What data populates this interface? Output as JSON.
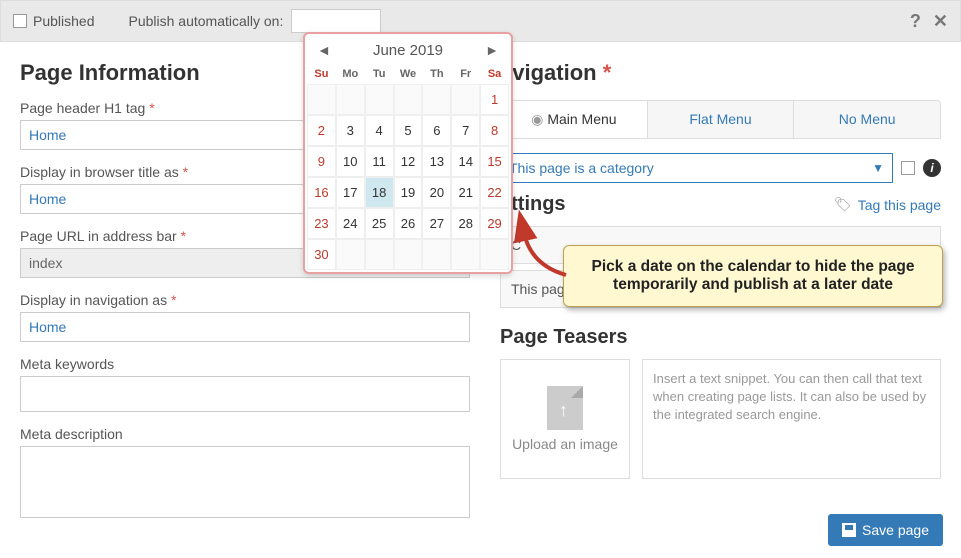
{
  "topbar": {
    "published_label": "Published",
    "publish_auto_label": "Publish automatically on:",
    "help_icon": "?",
    "close_icon": "✕"
  },
  "page_info": {
    "title": "Page Information",
    "fields": {
      "h1_label": "Page header H1 tag",
      "h1_value": "Home",
      "browser_title_label": "Display in browser title as",
      "browser_title_value": "Home",
      "url_label": "Page URL in address bar",
      "url_value": "index",
      "nav_label": "Display in navigation as",
      "nav_value": "Home",
      "meta_kw_label": "Meta keywords",
      "meta_desc_label": "Meta description"
    },
    "req_mark": "*"
  },
  "navigation": {
    "title": "avigation",
    "tabs": {
      "main": "Main Menu",
      "flat": "Flat Menu",
      "none": "No Menu"
    },
    "category_select": "This page is a category"
  },
  "settings": {
    "title": "ettings",
    "tag_link": "Tag this page",
    "current_row": "C",
    "teaser_row": "This page"
  },
  "teasers": {
    "title": "Page Teasers",
    "upload_label": "Upload an image",
    "snippet_placeholder": "Insert a text snippet. You can then call that text when creating page lists. It can also be used by the integrated search engine."
  },
  "save_button": "Save page",
  "calendar": {
    "title": "June 2019",
    "day_headers": [
      "Su",
      "Mo",
      "Tu",
      "We",
      "Th",
      "Fr",
      "Sa"
    ],
    "weeks": [
      [
        null,
        null,
        null,
        null,
        null,
        null,
        {
          "n": 1,
          "we": true
        }
      ],
      [
        {
          "n": 2,
          "we": true
        },
        {
          "n": 3
        },
        {
          "n": 4
        },
        {
          "n": 5
        },
        {
          "n": 6
        },
        {
          "n": 7
        },
        {
          "n": 8,
          "we": true
        }
      ],
      [
        {
          "n": 9,
          "we": true
        },
        {
          "n": 10
        },
        {
          "n": 11
        },
        {
          "n": 12
        },
        {
          "n": 13
        },
        {
          "n": 14
        },
        {
          "n": 15,
          "we": true
        }
      ],
      [
        {
          "n": 16,
          "we": true
        },
        {
          "n": 17
        },
        {
          "n": 18,
          "sel": true
        },
        {
          "n": 19
        },
        {
          "n": 20
        },
        {
          "n": 21
        },
        {
          "n": 22,
          "we": true
        }
      ],
      [
        {
          "n": 23,
          "we": true
        },
        {
          "n": 24
        },
        {
          "n": 25
        },
        {
          "n": 26
        },
        {
          "n": 27
        },
        {
          "n": 28
        },
        {
          "n": 29,
          "we": true
        }
      ],
      [
        {
          "n": 30,
          "we": true
        },
        null,
        null,
        null,
        null,
        null,
        null
      ]
    ]
  },
  "callout": {
    "text": "Pick a date on the calendar to hide the page temporarily and publish at a later date"
  }
}
